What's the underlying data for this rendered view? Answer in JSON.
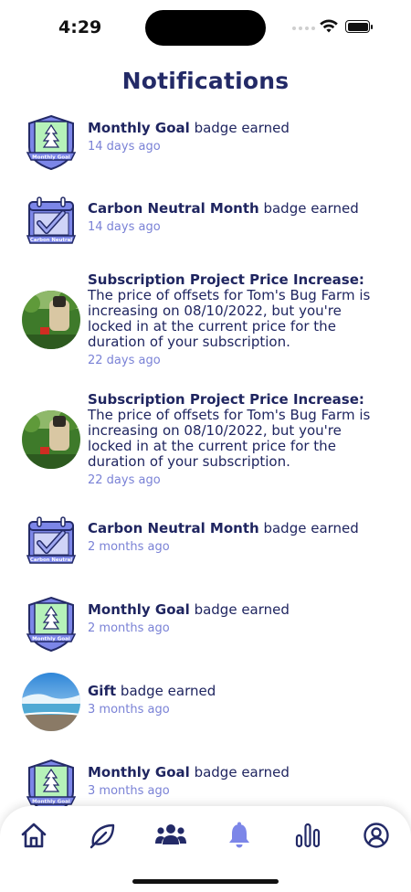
{
  "status": {
    "time": "4:29"
  },
  "page": {
    "title": "Notifications"
  },
  "notifications": [
    {
      "icon": "monthly-goal-badge",
      "badge_text": "Monthly Goal",
      "bold": "Monthly Goal",
      "rest": " badge earned",
      "ago": "14 days ago"
    },
    {
      "icon": "carbon-neutral-badge",
      "badge_text": "Carbon Neutral",
      "bold": "Carbon Neutral Month",
      "rest": " badge earned",
      "ago": "14 days ago"
    },
    {
      "icon": "project-photo",
      "bold": "Subscription Project Price Increase:",
      "rest": "  The price of offsets for Tom's Bug Farm is increasing on 08/10/2022, but you're locked in at the current price for the duration of your subscription.",
      "ago": "22 days ago"
    },
    {
      "icon": "project-photo",
      "bold": "Subscription Project Price Increase:",
      "rest": "  The price of offsets for Tom's Bug Farm is increasing on 08/10/2022, but you're locked in at the current price for the duration of your subscription.",
      "ago": "22 days ago"
    },
    {
      "icon": "carbon-neutral-badge",
      "badge_text": "Carbon Neutral",
      "bold": "Carbon Neutral Month",
      "rest": " badge earned",
      "ago": "2 months ago"
    },
    {
      "icon": "monthly-goal-badge",
      "badge_text": "Monthly Goal",
      "bold": "Monthly Goal",
      "rest": " badge earned",
      "ago": "2 months ago"
    },
    {
      "icon": "gift-photo",
      "bold": "Gift",
      "rest": " badge earned",
      "ago": "3 months ago"
    },
    {
      "icon": "monthly-goal-badge",
      "badge_text": "Monthly Goal",
      "bold": "Monthly Goal",
      "rest": " badge earned",
      "ago": "3 months ago"
    }
  ],
  "tabbar": {
    "items": [
      {
        "icon": "home-icon",
        "active": false
      },
      {
        "icon": "leaf-icon",
        "active": false
      },
      {
        "icon": "community-icon",
        "active": false
      },
      {
        "icon": "bell-icon",
        "active": true
      },
      {
        "icon": "stats-icon",
        "active": false
      },
      {
        "icon": "profile-icon",
        "active": false
      }
    ]
  },
  "colors": {
    "navy": "#232a67",
    "accent": "#6f79e0",
    "subtle": "#7a82d6",
    "badge_fill": "#7c86e8",
    "badge_green": "#b6f2b9"
  }
}
